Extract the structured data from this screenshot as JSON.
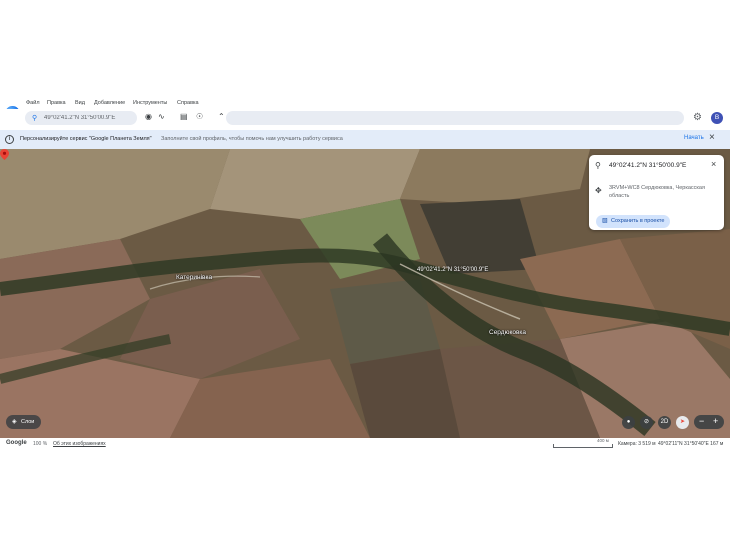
{
  "menu": [
    "Файл",
    "Правка",
    "Вид",
    "Добавление",
    "Инструменты",
    "Справка"
  ],
  "search": {
    "value": "49°02'41.2\"N 31°50'00.9\"E"
  },
  "account": {
    "initial": "B"
  },
  "banner": {
    "title": "Персонализируйте сервис \"Google Планета Земля\"",
    "description": "Заполните свой профиль, чтобы помочь нам улучшить работу сервиса",
    "action": "Начать"
  },
  "map": {
    "places": [
      "Катеринівка",
      "Сердюковка"
    ],
    "marker_label": "49°02'41.2\"N 31°50'00.9\"E"
  },
  "card": {
    "title": "49°02'41.2\"N 31°50'00.9\"E",
    "address": "3RVM+WC8 Сердюковка, Черкасская область",
    "save_label": "Сохранить в проекте"
  },
  "controls": {
    "layers_label": "Слои",
    "view_mode": "2D"
  },
  "status": {
    "brand": "Google",
    "percent": "100 %",
    "about_link": "Об этих изображениях",
    "scale": "400 м",
    "camera": "Камера: 3 519 м",
    "coordinates": "49°02'11\"N 31°50'40\"E  167 м"
  },
  "colors": {
    "accent": "#1a73e8",
    "banner_bg": "#e3ecf9",
    "avatar": "#3f51b5"
  }
}
